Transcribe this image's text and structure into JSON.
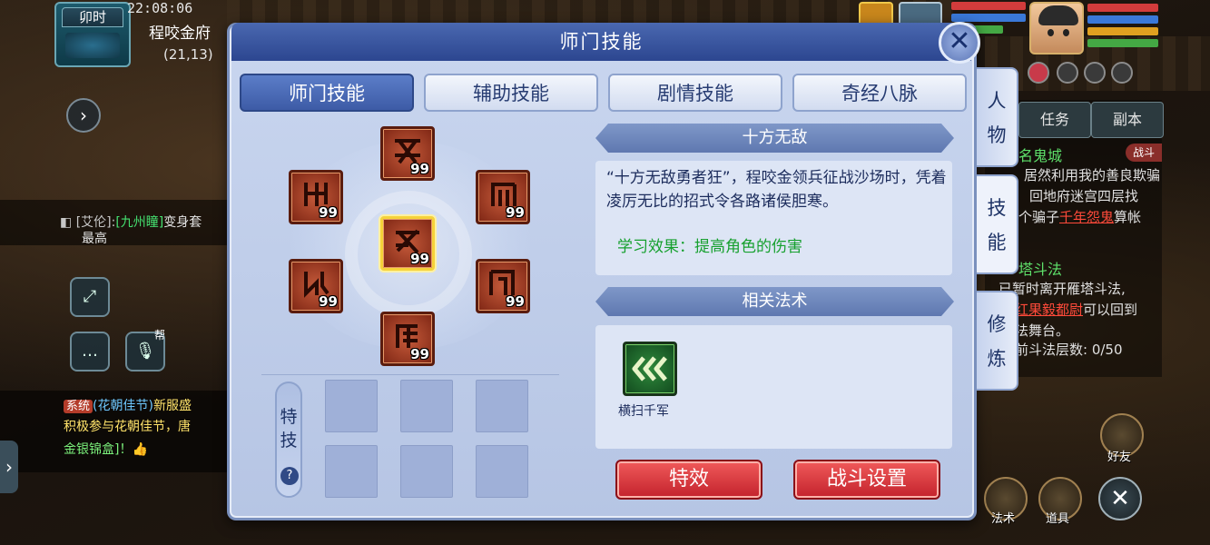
{
  "hud": {
    "shichen": "卯时",
    "clock": "22:08:06",
    "location": "程咬金府",
    "coords": "(21,13)"
  },
  "chat": {
    "line1_prefix": "[艾伦]:",
    "line1_channel": "[九州瞳]",
    "line1_text": "变身套",
    "line1_cont": "最高",
    "sys_tag": "系统",
    "sys_event": "(花朝佳节)",
    "sys_text": "新服盛",
    "sys_line2": "积极参与花朝佳节，唐",
    "sys_line3": "金银锦盒]！👍",
    "voice_badge": "帮"
  },
  "task_panel": {
    "tab_task": "任务",
    "tab_dungeon": "副本",
    "quest1_title": "名鬼城",
    "quest1_badge": "战斗",
    "quest1_l1": "居然利用我的善良欺骗",
    "quest1_l2": "回地府迷宫四层找",
    "quest1_l3_pre": "个骗子",
    "quest1_l3_link": "千年怨鬼",
    "quest1_l3_post": "算帐",
    "quest2_title": "塔斗法",
    "quest2_l1": "已暂时离开雁塔斗法,",
    "quest2_l2_link": "红果毅都尉",
    "quest2_l2_post": "可以回到",
    "quest2_l3": "法舞台。",
    "quest2_l4": "前斗法层数: 0/50"
  },
  "actions": {
    "friends": "好友",
    "spells": "法术",
    "items": "道具"
  },
  "dialog": {
    "title": "师门技能",
    "tabs": [
      "师门技能",
      "辅助技能",
      "剧情技能",
      "奇经八脉"
    ],
    "active_tab": 0,
    "side_tabs": [
      "人物",
      "技能",
      "修炼"
    ],
    "active_side_tab": 1
  },
  "skills": [
    {
      "name": "skill-top",
      "level": "99"
    },
    {
      "name": "skill-upper-left",
      "level": "99"
    },
    {
      "name": "skill-upper-right",
      "level": "99"
    },
    {
      "name": "skill-center",
      "level": "99",
      "selected": true
    },
    {
      "name": "skill-lower-left",
      "level": "99"
    },
    {
      "name": "skill-lower-right",
      "level": "99"
    },
    {
      "name": "skill-bottom",
      "level": "99"
    }
  ],
  "special": {
    "label_1": "特",
    "label_2": "技",
    "help": "?"
  },
  "detail": {
    "skill_name": "十方无敌",
    "description": "“十方无敌勇者狂”，程咬金领兵征战沙场时，凭着凌厉无比的招式令各路诸侯胆寒。",
    "effect": "学习效果：提高角色的伤害",
    "related_header": "相关法术",
    "related_spell": "横扫千军"
  },
  "buttons": {
    "effects": "特效",
    "battle_settings": "战斗设置"
  },
  "colors": {
    "dialog_bg": "#c9d6ef",
    "tab_active": "#3d5ba6",
    "skill_frame": "#7e2614",
    "selected_border": "#f5d23a",
    "effect_text": "#16a02e",
    "red_button": "#c3222c"
  }
}
